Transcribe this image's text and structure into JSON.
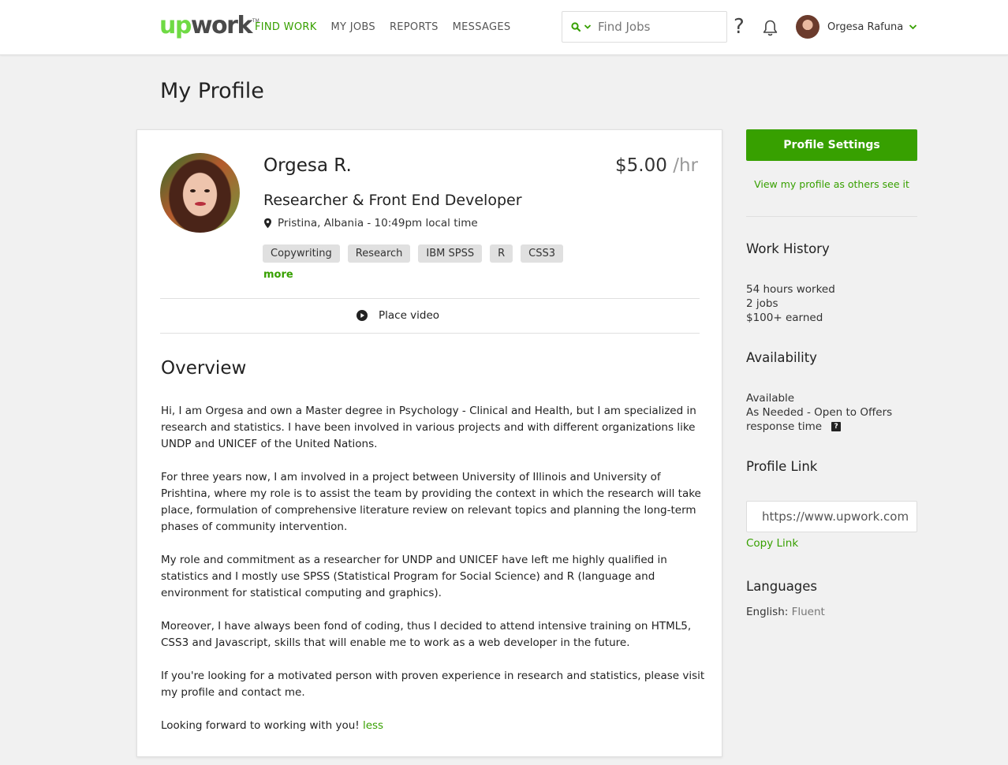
{
  "colors": {
    "brand_green": "#37a000",
    "logo_green": "#6fda44",
    "background": "#f1f1f1"
  },
  "header": {
    "logo": {
      "part1": "up",
      "part2": "work",
      "tm": "TM"
    },
    "nav": [
      "FIND WORK",
      "MY JOBS",
      "REPORTS",
      "MESSAGES"
    ],
    "search": {
      "placeholder": "Find Jobs",
      "icon": "search-icon"
    },
    "help_icon": "?",
    "user_name": "Orgesa Rafuna"
  },
  "page_title": "My Profile",
  "profile": {
    "name": "Orgesa R.",
    "rate": "$5.00",
    "rate_unit": "/hr",
    "title": "Researcher & Front End Developer",
    "location": "Pristina, Albania - 10:49pm local time",
    "skills": [
      "Copywriting",
      "Research",
      "IBM SPSS",
      "R",
      "CSS3"
    ],
    "more_label": "more",
    "video_label": "Place video"
  },
  "overview": {
    "title": "Overview",
    "paragraphs": [
      "Hi, I am Orgesa and own a Master degree in Psychology - Clinical and Health, but I am specialized in research and statistics. I have been involved in various projects and with different organizations like UNDP and UNICEF of the United Nations.",
      "For three years now, I am involved in a project between University of Illinois and University of Prishtina, where my role is to assist the team by providing the context in which the research will take place, formulation of comprehensive literature review on relevant topics and planning the long-term phases of community intervention.",
      "My role and commitment as a researcher for UNDP and UNICEF have left me highly qualified in statistics and I mostly use SPSS (Statistical Program for Social Science) and R (language and environment for statistical computing and graphics).",
      "Moreover, I have always been fond of coding, thus I decided to attend intensive training on HTML5, CSS3 and Javascript, skills that will enable me to work as a web developer in the future.",
      "If you're looking for a motivated person with proven experience in research and statistics, please visit my profile and contact me.",
      "Looking forward to working with you!"
    ],
    "less_label": "less"
  },
  "sidebar": {
    "settings_button": "Profile Settings",
    "view_as": "View my profile as others see it",
    "work_history": {
      "title": "Work History",
      "hours": "54 hours worked",
      "jobs": "2 jobs",
      "earned": "$100+ earned"
    },
    "availability": {
      "title": "Availability",
      "status": "Available",
      "detail": "As Needed - Open to Offers",
      "response": "response time",
      "help_icon": "?"
    },
    "profile_link": {
      "title": "Profile Link",
      "value": "https://www.upwork.com",
      "copy_label": "Copy Link"
    },
    "languages": {
      "title": "Languages",
      "language": "English:",
      "level": "Fluent"
    }
  }
}
